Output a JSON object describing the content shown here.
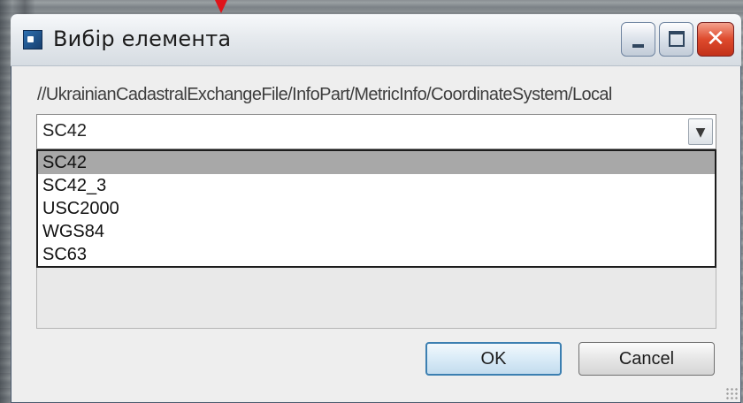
{
  "dialog": {
    "title": "Вибір елемента",
    "xpath": "//UkrainianCadastralExchangeFile/InfoPart/MetricInfo/CoordinateSystem/Local",
    "combo": {
      "selected_value": "SC42"
    },
    "options": [
      "SC42",
      "SC42_3",
      "USC2000",
      "WGS84",
      "SC63"
    ],
    "selected_option_index": 0,
    "buttons": {
      "ok": "OK",
      "cancel": "Cancel"
    },
    "caption_buttons": {
      "minimize": "minimize-icon",
      "maximize": "maximize-icon",
      "close": "close-icon"
    },
    "colors": {
      "close_button": "#de4a2c",
      "marker": "#e0141a",
      "ok_border": "#3c7fb1"
    }
  }
}
